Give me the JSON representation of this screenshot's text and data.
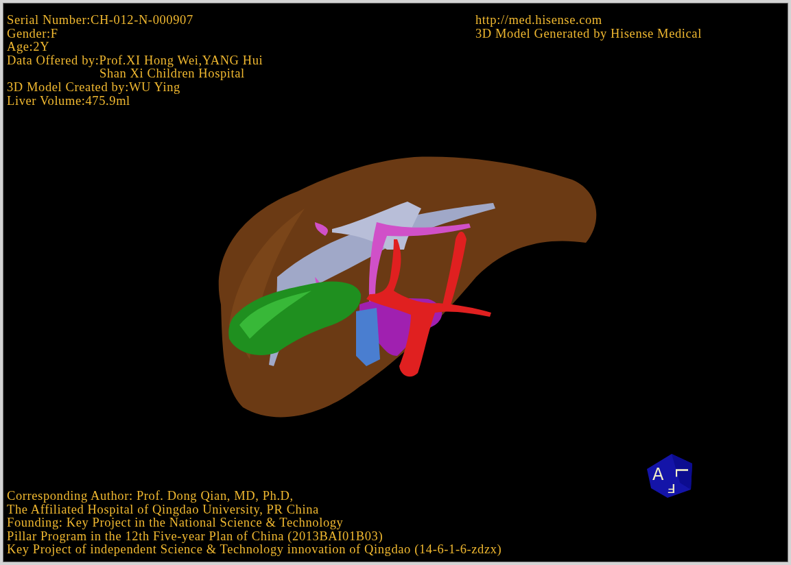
{
  "patient_info": [
    {
      "kind": "line",
      "text": "Serial Number:CH-012-N-000907"
    },
    {
      "kind": "line",
      "text": "Gender:F"
    },
    {
      "kind": "line",
      "text": "Age:2Y"
    },
    {
      "kind": "line",
      "text": "Data Offered by:Prof.XI Hong Wei,YANG Hui"
    },
    {
      "kind": "continued",
      "text": "Shan Xi Children Hospital"
    },
    {
      "kind": "line",
      "text": "3D Model Created by:WU Ying"
    },
    {
      "kind": "line",
      "text": "Liver Volume:475.9ml"
    }
  ],
  "producer_info": {
    "website": "http://med.hisense.com",
    "note": "3D Model Generated by Hisense Medical"
  },
  "credits": [
    "Corresponding Author: Prof. Dong Qian, MD, Ph.D,",
    "The Affiliated Hospital of Qingdao University, PR China",
    "Founding: Key Project in the National Science & Technology",
    "Pillar Program in the 12th Five-year Plan of China (2013BAI01B03)",
    "Key Project of independent Science & Technology innovation of Qingdao (14-6-1-6-zdzx)"
  ],
  "orientation_cube": {
    "faces": [
      "A",
      "L",
      "F"
    ]
  }
}
